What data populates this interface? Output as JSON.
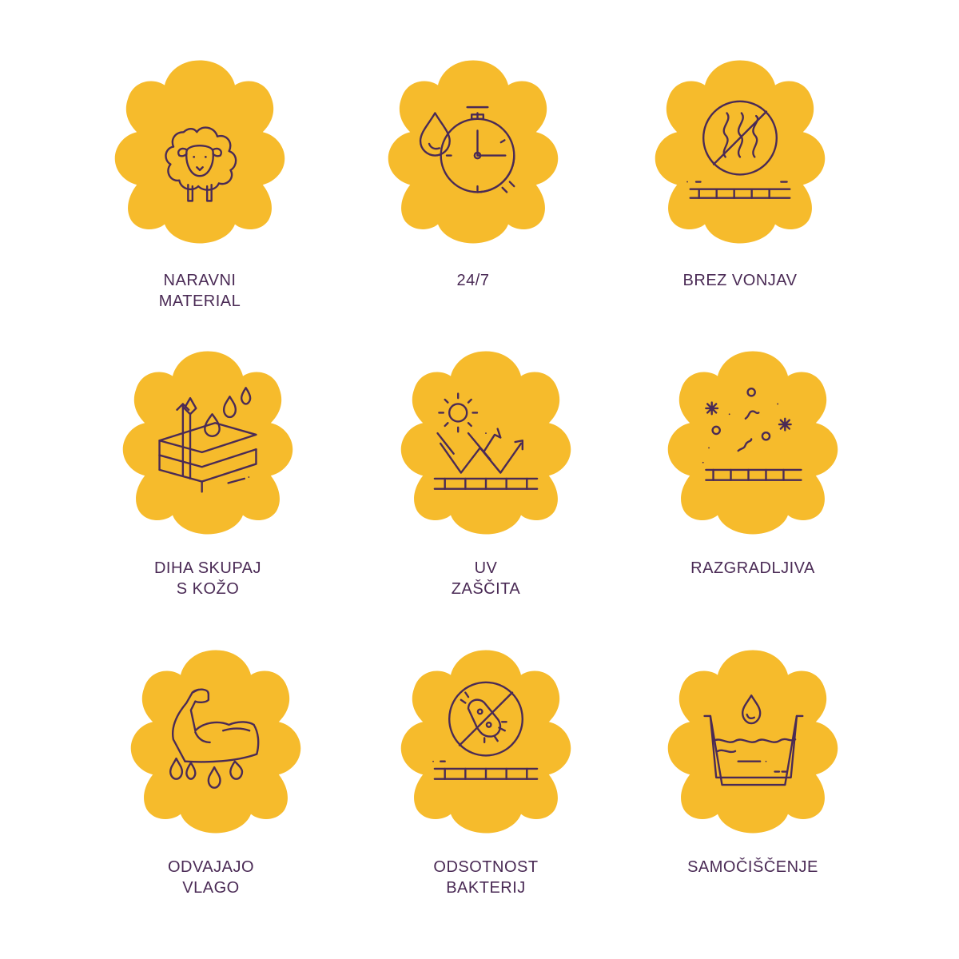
{
  "colors": {
    "badge": "#f6bb2c",
    "line": "#4a2a55",
    "background": "#ffffff"
  },
  "features": [
    {
      "icon": "sheep-icon",
      "label": "NARAVNI\nMATERIAL"
    },
    {
      "icon": "stopwatch-drop-icon",
      "label": "24/7"
    },
    {
      "icon": "no-odor-icon",
      "label": "BREZ VONJAV"
    },
    {
      "icon": "breathable-layers-icon",
      "label": "DIHA SKUPAJ\nS KOŽO"
    },
    {
      "icon": "uv-protection-icon",
      "label": "UV\nZAŠČITA"
    },
    {
      "icon": "biodegradable-icon",
      "label": "RAZGRADLJIVA"
    },
    {
      "icon": "moisture-wicking-arm-icon",
      "label": "ODVAJAJO\nVLAGO"
    },
    {
      "icon": "no-bacteria-icon",
      "label": "ODSOTNOST\nBAKTERIJ"
    },
    {
      "icon": "self-cleaning-icon",
      "label": "SAMOČIŠČENJE"
    }
  ]
}
